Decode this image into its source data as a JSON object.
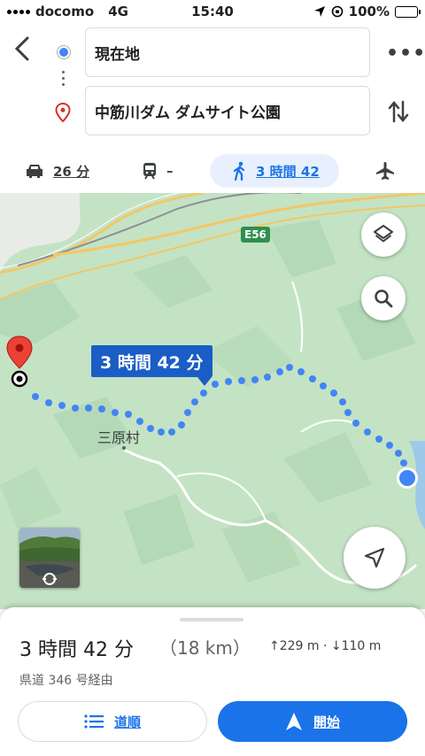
{
  "status_bar": {
    "carrier": "docomo",
    "network": "4G",
    "time": "15:40",
    "battery": "100%"
  },
  "header": {
    "origin": "現在地",
    "destination": "中筋川ダム ダムサイト公園"
  },
  "modes": [
    {
      "id": "car",
      "label": "26 分"
    },
    {
      "id": "transit",
      "label": "–"
    },
    {
      "id": "walk",
      "label": "3 時間 42",
      "active": true
    },
    {
      "id": "flight",
      "label": ""
    }
  ],
  "map": {
    "route_label": "3 時間 42 分",
    "village": "三原村",
    "road_shield": "E56",
    "route_color": "#4285f4",
    "label_color": "#1a5ec5"
  },
  "summary": {
    "duration": "3 時間 42 分",
    "distance": "（18 km）",
    "elevation": "↑229 m · ↓110 m",
    "via": "県道 346 号経由"
  },
  "buttons": {
    "steps": "道順",
    "start": "開始"
  },
  "colors": {
    "accent": "#1a73e8",
    "active_tab_bg": "#e8f0fe"
  }
}
